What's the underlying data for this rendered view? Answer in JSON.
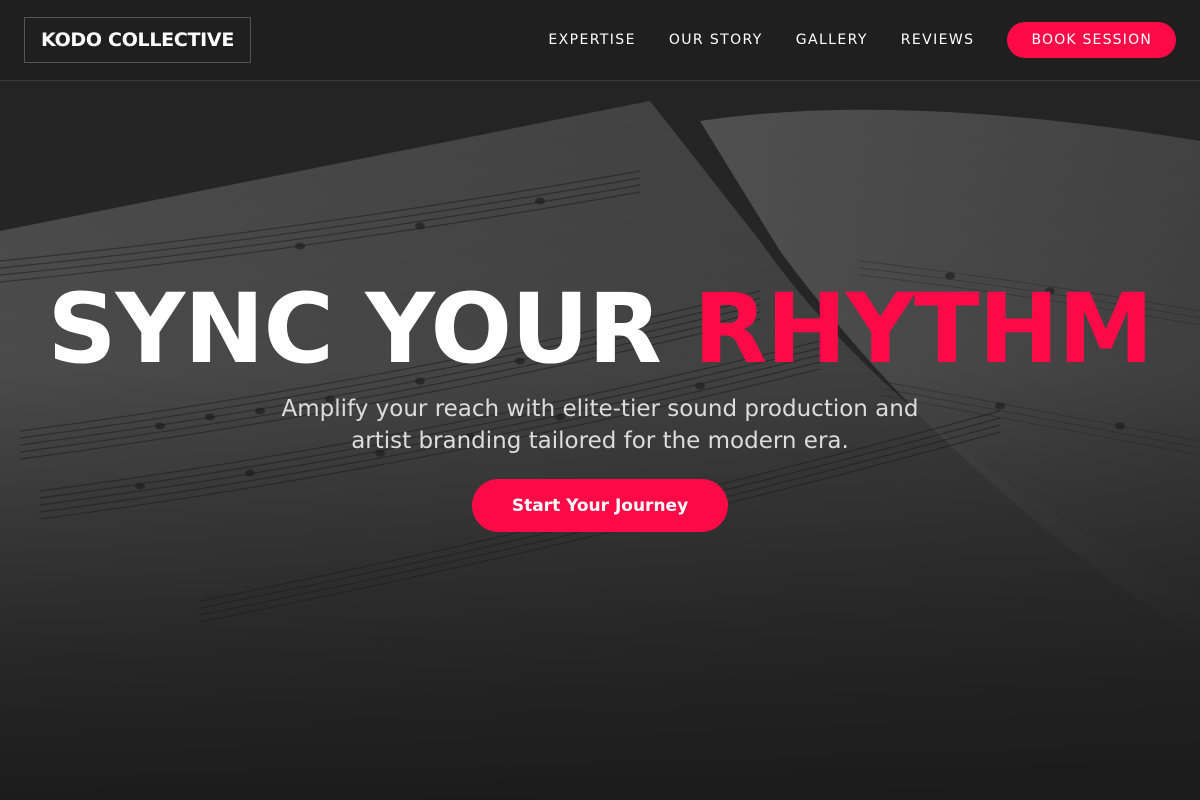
{
  "header": {
    "logo": "KODO COLLECTIVE",
    "nav": [
      {
        "label": "EXPERTISE"
      },
      {
        "label": "OUR STORY"
      },
      {
        "label": "GALLERY"
      },
      {
        "label": "REVIEWS"
      }
    ],
    "cta_label": "BOOK SESSION"
  },
  "hero": {
    "headline_main": "SYNC YOUR",
    "headline_accent": "RHYTHM",
    "subtitle": "Amplify your reach with elite-tier sound production and artist branding tailored for the modern era.",
    "cta_label": "Start Your Journey",
    "background": "sheet-music-photo"
  },
  "colors": {
    "accent": "#ff0a47",
    "header_bg": "#1f1f1f",
    "page_bg": "#1b1b1b"
  }
}
